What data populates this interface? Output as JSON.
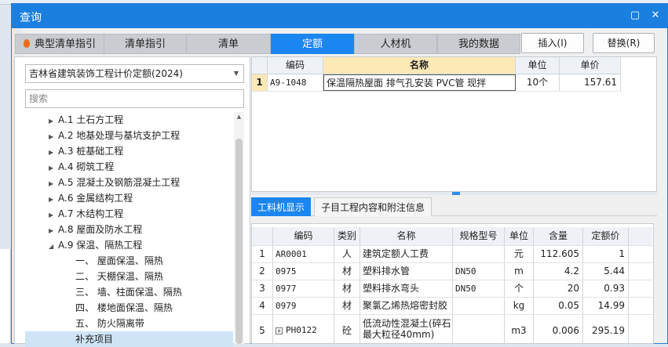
{
  "title": "查询",
  "main_tabs": [
    {
      "label": "典型清单指引",
      "active": false
    },
    {
      "label": "清单指引",
      "active": false
    },
    {
      "label": "清单",
      "active": false
    },
    {
      "label": "定额",
      "active": true
    },
    {
      "label": "人材机",
      "active": false
    },
    {
      "label": "我的数据",
      "active": false
    }
  ],
  "buttons": {
    "insert": "插入(I)",
    "replace": "替换(R)"
  },
  "quota_library": "吉林省建筑装饰工程计价定额(2024)",
  "search_placeholder": "搜索",
  "tree": [
    {
      "label": "A.1 土石方工程",
      "level": 1,
      "expander": "▶"
    },
    {
      "label": "A.2 地基处理与基坑支护工程",
      "level": 1,
      "expander": "▶"
    },
    {
      "label": "A.3 桩基础工程",
      "level": 1,
      "expander": "▶"
    },
    {
      "label": "A.4 砌筑工程",
      "level": 1,
      "expander": "▶"
    },
    {
      "label": "A.5 混凝土及钢筋混凝土工程",
      "level": 1,
      "expander": "▶"
    },
    {
      "label": "A.6 金属结构工程",
      "level": 1,
      "expander": "▶"
    },
    {
      "label": "A.7 木结构工程",
      "level": 1,
      "expander": "▶"
    },
    {
      "label": "A.8 屋面及防水工程",
      "level": 1,
      "expander": "▶"
    },
    {
      "label": "A.9 保温、隔热工程",
      "level": 1,
      "expander": "◢"
    },
    {
      "label": "一、 屋面保温、隔热",
      "level": 2,
      "expander": ""
    },
    {
      "label": "二、 天棚保温、隔热",
      "level": 2,
      "expander": ""
    },
    {
      "label": "三、 墙、柱面保温、隔热",
      "level": 2,
      "expander": ""
    },
    {
      "label": "四、 楼地面保温、隔热",
      "level": 2,
      "expander": ""
    },
    {
      "label": "五、 防火隔离带",
      "level": 2,
      "expander": ""
    },
    {
      "label": "补充项目",
      "level": 2,
      "expander": "",
      "selected": true
    }
  ],
  "quota_table": {
    "headers": {
      "code": "编码",
      "name": "名称",
      "unit": "单位",
      "price": "单价"
    },
    "rows": [
      {
        "index": "1",
        "code": "A9-1048",
        "name": "保温隔热屋面 排气孔安装 PVC管 现拌",
        "unit": "10个",
        "price": "157.61"
      }
    ]
  },
  "sub_tabs": [
    {
      "label": "工料机显示",
      "active": true
    },
    {
      "label": "子目工程内容和附注信息",
      "active": false
    }
  ],
  "material_table": {
    "headers": {
      "code": "编码",
      "category": "类别",
      "name": "名称",
      "spec": "规格型号",
      "unit": "单位",
      "qty": "含量",
      "price": "定额价"
    },
    "rows": [
      {
        "index": "1",
        "code": "AR0001",
        "category": "人",
        "name": "建筑定额人工费",
        "spec": "",
        "unit": "元",
        "qty": "112.605",
        "price": "1"
      },
      {
        "index": "2",
        "code": "0975",
        "category": "材",
        "name": "塑料排水管",
        "spec": "DN50",
        "unit": "m",
        "qty": "4.2",
        "price": "5.44"
      },
      {
        "index": "3",
        "code": "0977",
        "category": "材",
        "name": "塑料排水弯头",
        "spec": "DN50",
        "unit": "个",
        "qty": "20",
        "price": "0.93"
      },
      {
        "index": "4",
        "code": "0979",
        "category": "材",
        "name": "聚氯乙烯热熔密封胶",
        "spec": "",
        "unit": "kg",
        "qty": "0.05",
        "price": "14.99"
      },
      {
        "index": "5",
        "code": "PH0122",
        "category": "砼",
        "name": "低流动性混凝土(碎石最大粒径40mm)",
        "spec": "",
        "unit": "m3",
        "qty": "0.006",
        "price": "295.19",
        "expandable": true
      }
    ]
  },
  "colors": {
    "accent": "#1b86ef",
    "titlebar": "#1b7fe0",
    "selected_row": "#cfe4f7"
  },
  "icons": [
    "flame-icon",
    "minimize-icon",
    "close-icon",
    "dropdown-arrow-icon",
    "tree-expander-icon",
    "expand-plus-icon"
  ]
}
